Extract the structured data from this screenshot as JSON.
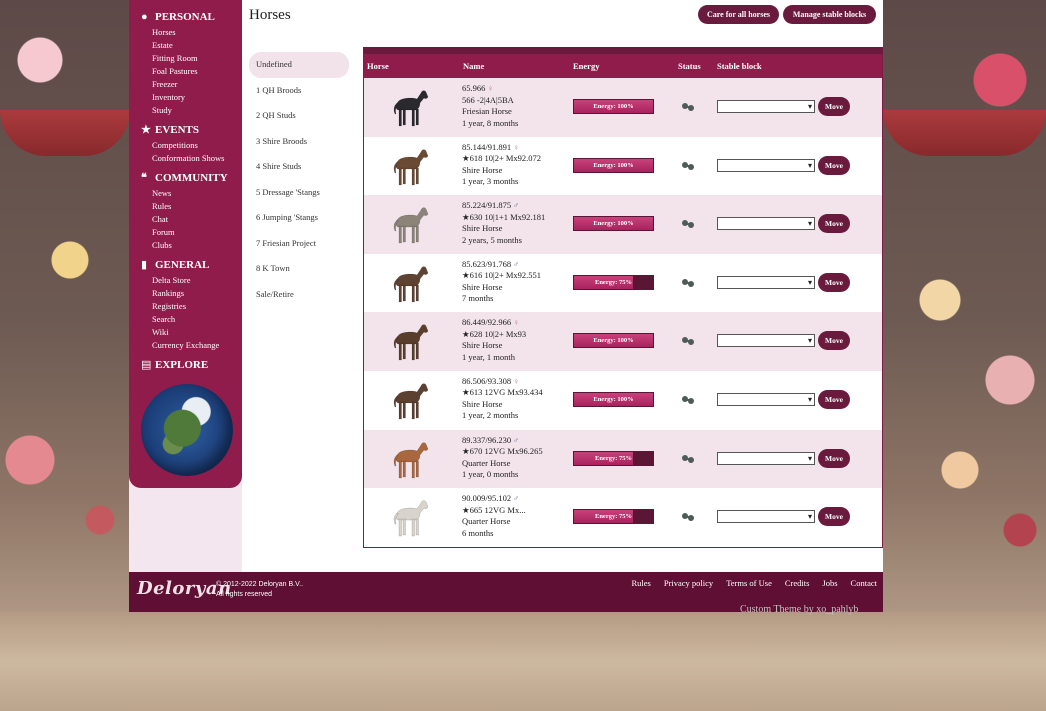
{
  "sidebar": {
    "sections": [
      {
        "title": "PERSONAL",
        "icon": "user-icon",
        "items": [
          "Horses",
          "Estate",
          "Fitting Room",
          "Foal Pastures",
          "Freezer",
          "Inventory",
          "Study"
        ]
      },
      {
        "title": "EVENTS",
        "icon": "star-icon",
        "items": [
          "Competitions",
          "Conformation Shows"
        ]
      },
      {
        "title": "COMMUNITY",
        "icon": "chat-icon",
        "items": [
          "News",
          "Rules",
          "Chat",
          "Forum",
          "Clubs"
        ]
      },
      {
        "title": "GENERAL",
        "icon": "bookmark-icon",
        "items": [
          "Delta Store",
          "Rankings",
          "Registries",
          "Search",
          "Wiki",
          "Currency Exchange"
        ]
      },
      {
        "title": "EXPLORE",
        "icon": "map-icon",
        "items": []
      }
    ]
  },
  "header": {
    "title": "Horses",
    "care_button": "Care for all horses",
    "manage_button": "Manage stable blocks"
  },
  "stables": [
    "Undefined",
    "1 QH Broods",
    "2 QH Studs",
    "3 Shire Broods",
    "4 Shire Studs",
    "5 Dressage 'Stangs",
    "6 Jumping 'Stangs",
    "7 Friesian Project",
    "8 K Town",
    "Sale/Retire"
  ],
  "table": {
    "headers": {
      "horse": "Horse",
      "name": "Name",
      "energy": "Energy",
      "status": "Status",
      "block": "Stable block"
    },
    "move_label": "Move",
    "rows": [
      {
        "score": "65.966",
        "gender": "♀",
        "gender_class": "g-f",
        "genes": "566 -2|4A|5BA",
        "breed": "Friesian Horse",
        "age": "1 year, 8 months",
        "energy": "Energy: 100%",
        "energy_level": 100,
        "coat": "#2a2a2e"
      },
      {
        "score": "85.144/91.891",
        "gender": "♀",
        "gender_class": "g-f",
        "genes": "★618 10|2+ Mx92.072",
        "breed": "Shire Horse",
        "age": "1 year, 3 months",
        "energy": "Energy: 100%",
        "energy_level": 100,
        "coat": "#6b4a34"
      },
      {
        "score": "85.224/91.875",
        "gender": "♂",
        "gender_class": "g-m",
        "genes": "★630 10|1+1 Mx92.181",
        "breed": "Shire Horse",
        "age": "2 years, 5 months",
        "energy": "Energy: 100%",
        "energy_level": 100,
        "coat": "#8c8478"
      },
      {
        "score": "85.623/91.768",
        "gender": "♂",
        "gender_class": "g-m",
        "genes": "★616 10|2+ Mx92.551",
        "breed": "Shire Horse",
        "age": "7 months",
        "energy": "Energy: 75%",
        "energy_level": 75,
        "coat": "#5e4232"
      },
      {
        "score": "86.449/92.966",
        "gender": "♀",
        "gender_class": "g-f",
        "genes": "★628 10|2+ Mx93",
        "breed": "Shire Horse",
        "age": "1 year, 1 month",
        "energy": "Energy: 100%",
        "energy_level": 100,
        "coat": "#5a3e2c"
      },
      {
        "score": "86.506/93.308",
        "gender": "♀",
        "gender_class": "g-f",
        "genes": "★613 12VG Mx93.434",
        "breed": "Shire Horse",
        "age": "1 year, 2 months",
        "energy": "Energy: 100%",
        "energy_level": 100,
        "coat": "#5c4030"
      },
      {
        "score": "89.337/96.230",
        "gender": "♂",
        "gender_class": "g-m",
        "genes": "★670 12VG Mx96.265",
        "breed": "Quarter Horse",
        "age": "1 year, 0 months",
        "energy": "Energy: 75%",
        "energy_level": 75,
        "coat": "#a8673e"
      },
      {
        "score": "90.009/95.102",
        "gender": "♂",
        "gender_class": "g-m",
        "genes": "★665 12VG Mx...",
        "breed": "Quarter Horse",
        "age": "6 months",
        "energy": "Energy: 75%",
        "energy_level": 75,
        "coat": "#d8d4cc"
      }
    ]
  },
  "footer": {
    "logo": "Deloryan",
    "copyright_line1": "© 2012-2022 Deloryan B.V..",
    "copyright_line2": "All rights reserved",
    "links": [
      "Rules",
      "Privacy policy",
      "Terms of Use",
      "Credits",
      "Jobs",
      "Contact"
    ]
  },
  "theme_credit": "Custom Theme by xo_pahlyb",
  "colors": {
    "brand": "#8f1c4b",
    "brand_dark": "#5e0f33",
    "button": "#6a1a3c",
    "row_shade": "#f3e4ec"
  }
}
